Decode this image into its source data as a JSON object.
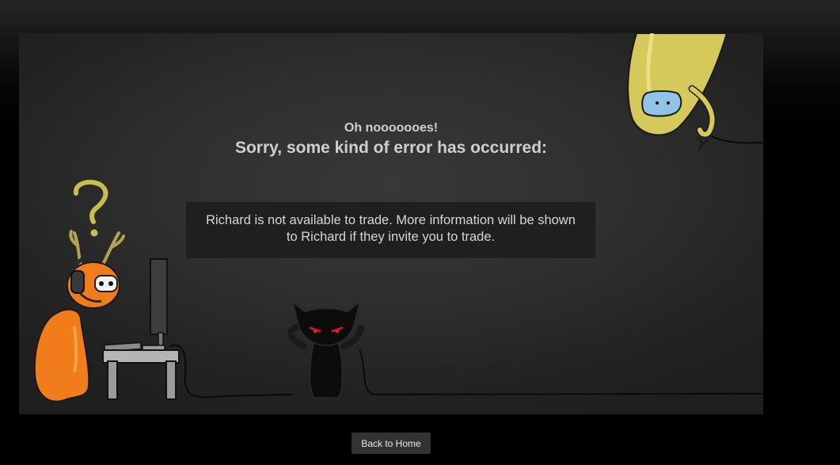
{
  "error": {
    "exclaim": "Oh nooooooes!",
    "heading": "Sorry, some kind of error has occurred:",
    "message": "Richard is not available to trade. More information will be shown to Richard if they invite you to trade."
  },
  "actions": {
    "back_label": "Back to Home"
  },
  "illustration": {
    "characters": [
      "orange-deer-character-icon",
      "black-cat-character-icon",
      "yellow-hanging-character-icon"
    ],
    "props": [
      "question-mark-icon",
      "computer-monitor-icon",
      "computer-desk-icon"
    ]
  }
}
